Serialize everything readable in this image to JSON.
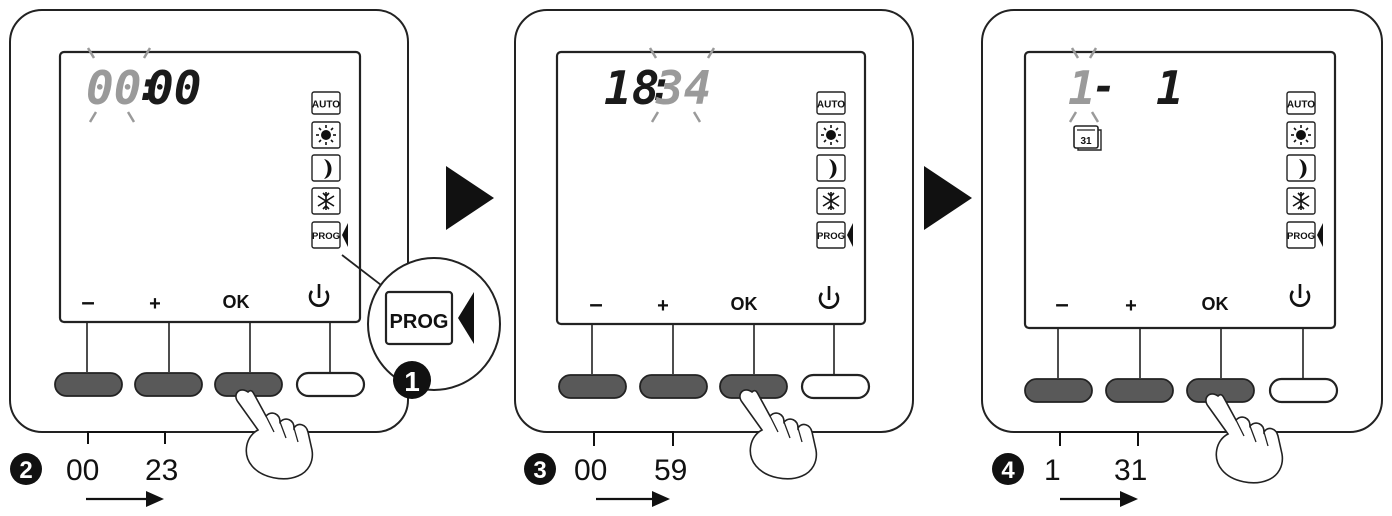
{
  "colors": {
    "ink": "#111111",
    "frame_fill": "#ffffff",
    "lcd_border": "#222222",
    "active_digits": "#1a1a1a",
    "blink_digits": "#9a9a9a",
    "button_dark": "#595959",
    "button_light": "#ffffff",
    "arrow": "#111111"
  },
  "icons": {
    "auto_label": "AUTO",
    "prog_label": "PROG",
    "sun": "sun-icon",
    "moon": "moon-icon",
    "snow": "snowflake-icon",
    "power": "power-icon",
    "calendar_label": "31",
    "hand": "pointing-hand-icon"
  },
  "buttons": {
    "minus": "–",
    "plus": "+",
    "ok": "OK"
  },
  "panels": [
    {
      "display": {
        "blink_part": "00",
        "sep": ":",
        "solid_part": "00"
      },
      "range": {
        "step": "2",
        "from": "00",
        "to": "23"
      }
    },
    {
      "display": {
        "solid_part": "18",
        "sep": ":",
        "blink_part": "34"
      },
      "range": {
        "step": "3",
        "from": "00",
        "to": "59"
      }
    },
    {
      "display": {
        "blink_part": "1",
        "sep": "-",
        "solid_part": "1"
      },
      "range": {
        "step": "4",
        "from": "1",
        "to": "31"
      }
    }
  ],
  "callout": {
    "step": "1",
    "label": "PROG"
  }
}
